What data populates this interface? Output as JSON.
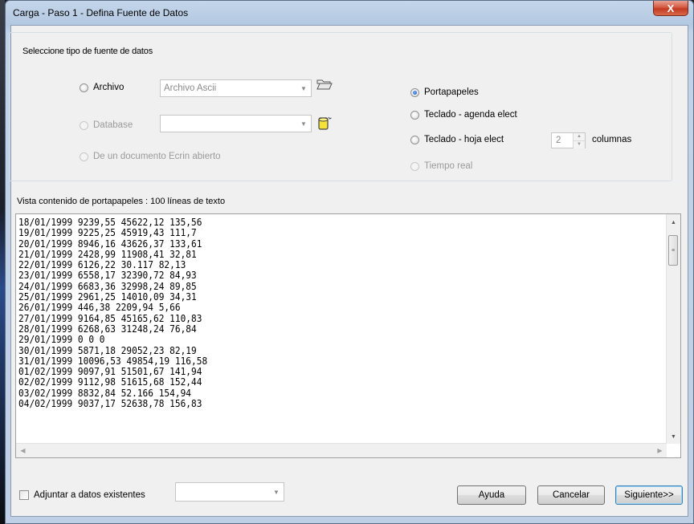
{
  "window": {
    "title": "Carga - Paso 1 - Defina Fuente de Datos",
    "close_glyph": "X"
  },
  "source_group": {
    "legend": "Seleccione tipo de fuente de datos",
    "archivo": {
      "label": "Archivo",
      "combo_value": "Archivo Ascii",
      "selected": false
    },
    "database": {
      "label": "Database",
      "combo_value": "",
      "selected": false
    },
    "ecrin": {
      "label": "De un documento Ecrin abierto",
      "selected": false
    },
    "portapapeles": {
      "label": "Portapapeles",
      "selected": true
    },
    "teclado_agenda": {
      "label": "Teclado - agenda elect",
      "selected": false
    },
    "teclado_hoja": {
      "label": "Teclado - hoja elect",
      "selected": false,
      "columns_value": "2",
      "columns_label": "columnas"
    },
    "tiempo_real": {
      "label": "Tiempo real",
      "selected": false
    }
  },
  "preview": {
    "caption": "Vista contenido de portapapeles : 100 líneas de texto",
    "lines": [
      "18/01/1999 9239,55 45622,12 135,56",
      "19/01/1999 9225,25 45919,43 111,7",
      "20/01/1999 8946,16 43626,37 133,61",
      "21/01/1999 2428,99 11908,41 32,81",
      "22/01/1999 6126,22 30.117 82,13",
      "23/01/1999 6558,17 32390,72 84,93",
      "24/01/1999 6683,36 32998,24 89,85",
      "25/01/1999 2961,25 14010,09 34,31",
      "26/01/1999 446,38 2209,94 5,66",
      "27/01/1999 9164,85 45165,62 110,83",
      "28/01/1999 6268,63 31248,24 76,84",
      "29/01/1999 0 0 0",
      "30/01/1999 5871,18 29052,23 82,19",
      "31/01/1999 10096,53 49854,19 116,58",
      "01/02/1999 9097,91 51501,67 141,94",
      "02/02/1999 9112,98 51615,68 152,44",
      "03/02/1999 8832,84 52.166 154,94",
      "04/02/1999 9037,17 52638,78 156,83"
    ]
  },
  "footer": {
    "append_label": "Adjuntar a datos existentes",
    "append_checked": false,
    "append_combo_value": "",
    "help_label": "Ayuda",
    "cancel_label": "Cancelar",
    "next_label": "Siguiente>>"
  },
  "colors": {
    "titlebar": "#b9cde5",
    "close": "#c7472e",
    "dialog_bg": "#f0f0f0",
    "default_border": "#3c7fb1"
  }
}
